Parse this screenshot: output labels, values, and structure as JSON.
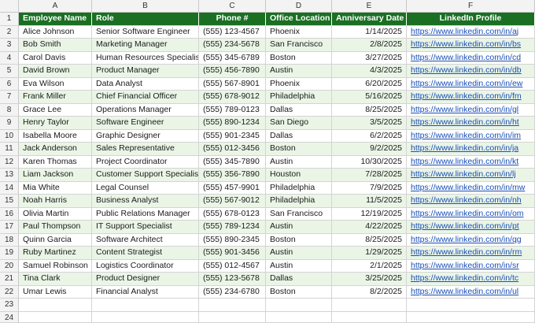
{
  "column_letters": [
    "A",
    "B",
    "C",
    "D",
    "E",
    "F"
  ],
  "headers": [
    "Employee Name",
    "Role",
    "Phone #",
    "Office Location",
    "Anniversary Date",
    "LinkedIn Profile"
  ],
  "rows": [
    [
      "Alice Johnson",
      "Senior Software Engineer",
      "(555) 123-4567",
      "Phoenix",
      "1/14/2025",
      "https://www.linkedin.com/in/aj"
    ],
    [
      "Bob Smith",
      "Marketing Manager",
      "(555) 234-5678",
      "San Francisco",
      "2/8/2025",
      "https://www.linkedin.com/in/bs"
    ],
    [
      "Carol Davis",
      "Human Resources Specialist",
      "(555) 345-6789",
      "Boston",
      "3/27/2025",
      "https://www.linkedin.com/in/cd"
    ],
    [
      "David Brown",
      "Product Manager",
      "(555) 456-7890",
      "Austin",
      "4/3/2025",
      "https://www.linkedin.com/in/db"
    ],
    [
      "Eva Wilson",
      "Data Analyst",
      "(555) 567-8901",
      "Phoenix",
      "6/20/2025",
      "https://www.linkedin.com/in/ew"
    ],
    [
      "Frank Miller",
      "Chief Financial Officer",
      "(555) 678-9012",
      "Philadelphia",
      "5/16/2025",
      "https://www.linkedin.com/in/fm"
    ],
    [
      "Grace Lee",
      "Operations Manager",
      "(555) 789-0123",
      "Dallas",
      "8/25/2025",
      "https://www.linkedin.com/in/gl"
    ],
    [
      "Henry Taylor",
      "Software Engineer",
      "(555) 890-1234",
      "San Diego",
      "3/5/2025",
      "https://www.linkedin.com/in/ht"
    ],
    [
      "Isabella Moore",
      "Graphic Designer",
      "(555) 901-2345",
      "Dallas",
      "6/2/2025",
      "https://www.linkedin.com/in/im"
    ],
    [
      "Jack Anderson",
      "Sales Representative",
      "(555) 012-3456",
      "Boston",
      "9/2/2025",
      "https://www.linkedin.com/in/ja"
    ],
    [
      "Karen Thomas",
      "Project Coordinator",
      "(555) 345-7890",
      "Austin",
      "10/30/2025",
      "https://www.linkedin.com/in/kt"
    ],
    [
      "Liam Jackson",
      "Customer Support Specialist",
      "(555) 356-7890",
      "Houston",
      "7/28/2025",
      "https://www.linkedin.com/in/lj"
    ],
    [
      "Mia White",
      "Legal Counsel",
      "(555) 457-9901",
      "Philadelphia",
      "7/9/2025",
      "https://www.linkedin.com/in/mw"
    ],
    [
      "Noah Harris",
      "Business Analyst",
      "(555) 567-9012",
      "Philadelphia",
      "11/5/2025",
      "https://www.linkedin.com/in/nh"
    ],
    [
      "Olivia Martin",
      "Public Relations Manager",
      "(555) 678-0123",
      "San Francisco",
      "12/19/2025",
      "https://www.linkedin.com/in/om"
    ],
    [
      "Paul Thompson",
      "IT Support Specialist",
      "(555) 789-1234",
      "Austin",
      "4/22/2025",
      "https://www.linkedin.com/in/pt"
    ],
    [
      "Quinn Garcia",
      "Software Architect",
      "(555) 890-2345",
      "Boston",
      "8/25/2025",
      "https://www.linkedin.com/in/qg"
    ],
    [
      "Ruby Martinez",
      "Content Strategist",
      "(555) 901-3456",
      "Austin",
      "1/29/2025",
      "https://www.linkedin.com/in/rm"
    ],
    [
      "Samuel Robinson",
      "Logistics Coordinator",
      "(555) 012-4567",
      "Austin",
      "2/1/2025",
      "https://www.linkedin.com/in/sr"
    ],
    [
      "Tina Clark",
      "Product Designer",
      "(555) 123-5678",
      "Dallas",
      "3/25/2025",
      "https://www.linkedin.com/in/tc"
    ],
    [
      "Umar Lewis",
      "Financial Analyst",
      "(555) 234-6780",
      "Boston",
      "8/2/2025",
      "https://www.linkedin.com/in/ul"
    ]
  ],
  "row_numbers": [
    "1",
    "2",
    "3",
    "4",
    "5",
    "6",
    "7",
    "8",
    "9",
    "10",
    "11",
    "12",
    "13",
    "14",
    "15",
    "16",
    "17",
    "18",
    "19",
    "20",
    "21",
    "22",
    "23",
    "24"
  ],
  "colors": {
    "header_bg": "#1a6f23",
    "stripe_bg": "#eaf5e6",
    "link": "#1a4fb5"
  }
}
